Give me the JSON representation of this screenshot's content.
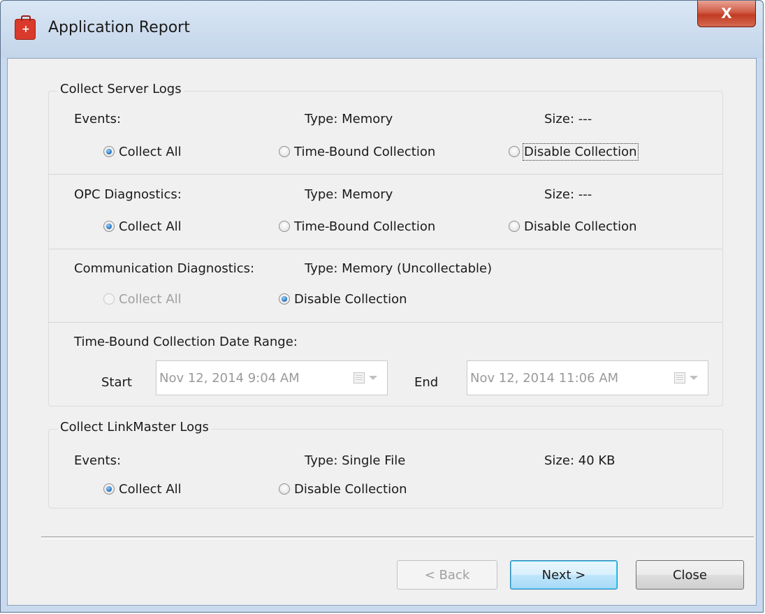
{
  "window": {
    "title": "Application Report",
    "close_glyph": "X"
  },
  "server_logs": {
    "title": "Collect Server Logs",
    "events": {
      "label": "Events:",
      "type": "Type:  Memory",
      "size": "Size:  ---",
      "options": [
        "Collect All",
        "Time-Bound Collection",
        "Disable Collection"
      ],
      "selected": "Collect All"
    },
    "opc": {
      "label": "OPC Diagnostics:",
      "type": "Type:  Memory",
      "size": "Size:  ---",
      "options": [
        "Collect All",
        "Time-Bound Collection",
        "Disable Collection"
      ],
      "selected": "Collect All"
    },
    "comm": {
      "label": "Communication Diagnostics:",
      "type": "Type: Memory (Uncollectable)",
      "options": [
        "Collect All",
        "Disable Collection"
      ],
      "selected": "Disable Collection"
    }
  },
  "date_range": {
    "title": "Time-Bound Collection Date Range:",
    "start_label": "Start",
    "start_value": "Nov 12, 2014  9:04 AM",
    "end_label": "End",
    "end_value": "Nov 12, 2014 11:06 AM"
  },
  "linkmaster_logs": {
    "title": "Collect LinkMaster Logs",
    "events": {
      "label": "Events:",
      "type": "Type:  Single File",
      "size": "Size:  40 KB",
      "options": [
        "Collect All",
        "Disable Collection"
      ],
      "selected": "Collect All"
    }
  },
  "buttons": {
    "back": "< Back",
    "next": "Next >",
    "close": "Close"
  },
  "colors": {
    "title_bar": "#c3d5ea",
    "close_button": "#c23b22",
    "radio_selected": "#2c78c6",
    "dialog_bg": "#f0f0f0"
  }
}
